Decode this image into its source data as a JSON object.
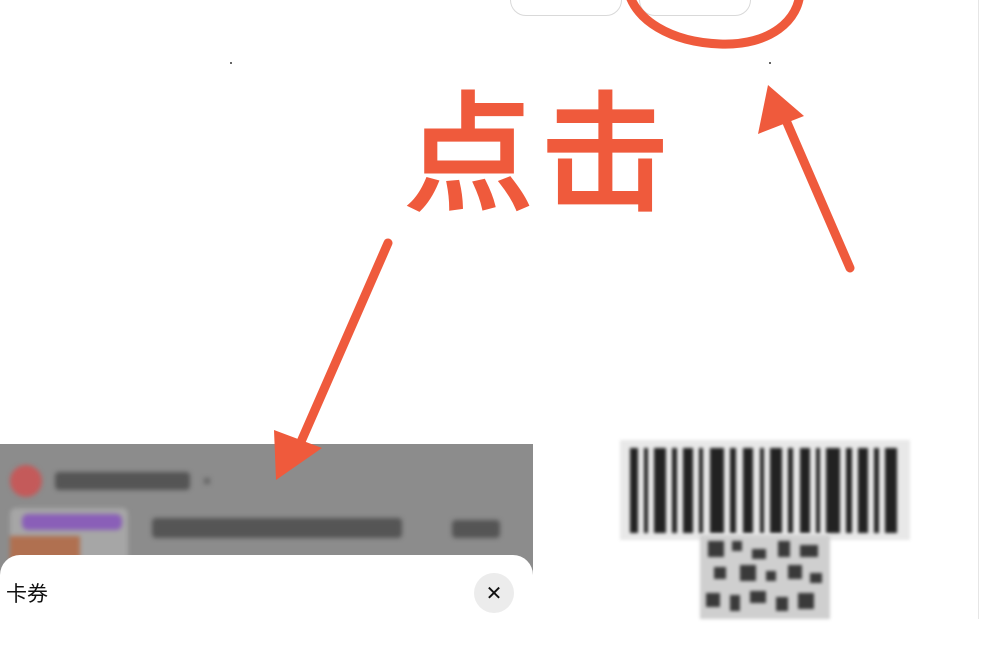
{
  "annotation": {
    "text": "点击",
    "color": "#ef5a3c"
  },
  "sheet": {
    "title": "卡券",
    "close_glyph": "✕"
  },
  "icons": {
    "close": "close-icon"
  }
}
